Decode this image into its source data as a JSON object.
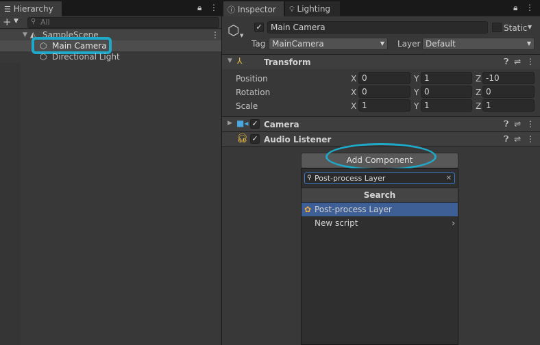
{
  "hierarchy": {
    "tab_label": "Hierarchy",
    "search_placeholder": "All",
    "scene_name": "SampleScene",
    "items": [
      {
        "label": "Main Camera"
      },
      {
        "label": "Directional Light"
      }
    ]
  },
  "inspector": {
    "tabs": [
      {
        "label": "Inspector"
      },
      {
        "label": "Lighting"
      }
    ],
    "object_name": "Main Camera",
    "static_label": "Static",
    "tag_label": "Tag",
    "tag_value": "MainCamera",
    "layer_label": "Layer",
    "layer_value": "Default",
    "transform": {
      "title": "Transform",
      "rows": [
        {
          "label": "Position",
          "x": "0",
          "y": "1",
          "z": "-10"
        },
        {
          "label": "Rotation",
          "x": "0",
          "y": "0",
          "z": "0"
        },
        {
          "label": "Scale",
          "x": "1",
          "y": "1",
          "z": "1"
        }
      ],
      "axis_x": "X",
      "axis_y": "Y",
      "axis_z": "Z"
    },
    "components": [
      {
        "title": "Camera"
      },
      {
        "title": "Audio Listener"
      }
    ],
    "add_component_label": "Add Component"
  },
  "add_component_popup": {
    "search_value": "Post-process Layer",
    "header": "Search",
    "items": [
      {
        "label": "Post-process Layer"
      },
      {
        "label": "New script"
      }
    ]
  },
  "colors": {
    "highlight_ring": "#1fa9c9",
    "selection": "#3e5f96"
  }
}
